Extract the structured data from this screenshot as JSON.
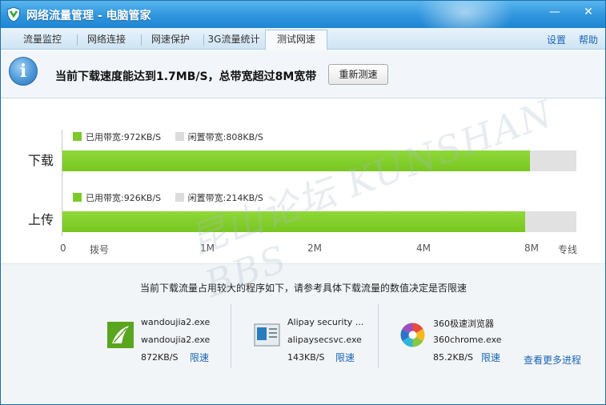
{
  "window": {
    "title": "网络流量管理 - 电脑管家"
  },
  "tabs": [
    {
      "label": "流量监控"
    },
    {
      "label": "网络连接"
    },
    {
      "label": "网速保护"
    },
    {
      "label": "3G流量统计"
    },
    {
      "label": "测试网速",
      "active": true
    }
  ],
  "toplinks": {
    "settings": "设置",
    "help": "帮助"
  },
  "header": {
    "message": "当前下载速度能达到1.7MB/S，总带宽超过8M宽带",
    "retest_label": "重新测速"
  },
  "chart_data": {
    "type": "bar",
    "orientation": "horizontal",
    "stacked": true,
    "categories": [
      "下载",
      "上传"
    ],
    "series": [
      {
        "name": "已用带宽",
        "color": "#7cc92a",
        "values": [
          0.909,
          0.9
        ]
      },
      {
        "name": "闲置带宽",
        "color": "#dcdcdc",
        "values": [
          0.091,
          0.1
        ]
      }
    ],
    "legend_text": [
      {
        "used": "已用带宽:972KB/S",
        "idle": "闲置带宽:808KB/S"
      },
      {
        "used": "已用带宽:926KB/S",
        "idle": "闲置带宽:214KB/S"
      }
    ],
    "x_ticks": [
      "0",
      "拨号",
      "1M",
      "2M",
      "4M",
      "8M",
      "专线"
    ]
  },
  "bottom": {
    "message": "当前下载流量占用较大的程序如下，请参考具体下载流量的数值决定是否限速",
    "processes": [
      {
        "icon": "wandoujia-icon",
        "name": "wandoujia2.exe",
        "exe": "wandoujia2.exe",
        "speed": "872KB/S",
        "limit": "限速"
      },
      {
        "icon": "alipay-security-icon",
        "name": "Alipay security ...",
        "exe": "alipaysecsvc.exe",
        "speed": "143KB/S",
        "limit": "限速"
      },
      {
        "icon": "360-browser-icon",
        "name": "360极速浏览器",
        "exe": "360chrome.exe",
        "speed": "85.2KB/S",
        "limit": "限速"
      }
    ],
    "more_label": "查看更多进程"
  },
  "watermark": "昆山论坛 KUNSHAN BBS",
  "colors": {
    "accent": "#2f95dc",
    "used": "#7cc92a",
    "idle": "#dcdcdc",
    "link": "#1a66b5"
  }
}
